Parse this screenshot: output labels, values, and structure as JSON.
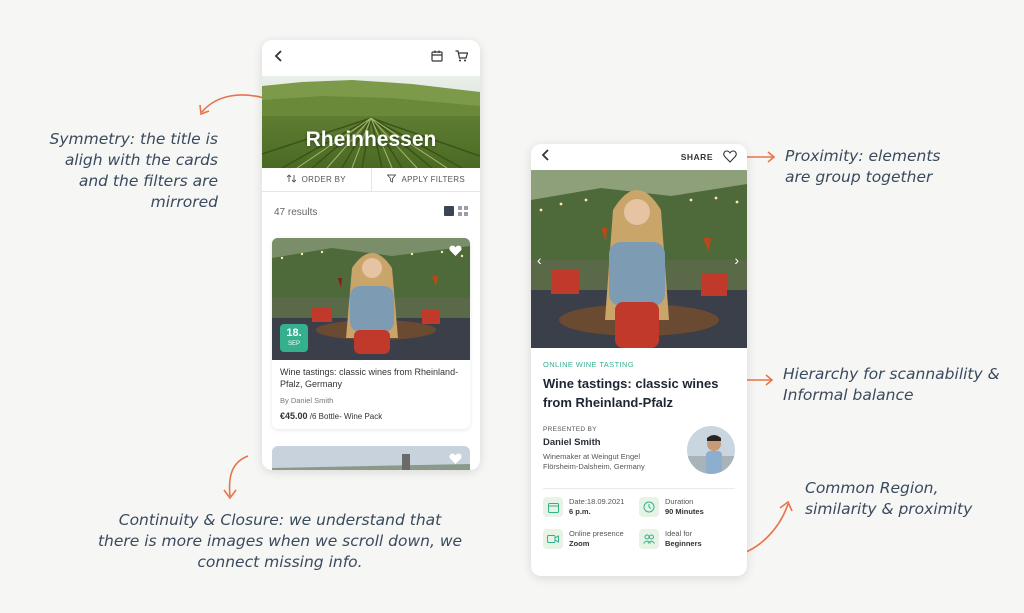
{
  "colors": {
    "accent": "#35b08f",
    "annotation_arrow": "#e8744a",
    "annotation_text": "#3a4a5e"
  },
  "annotations": {
    "symmetry": [
      "Symmetry: the title is",
      "aligh with the cards",
      "and the filters are",
      "mirrored"
    ],
    "continuity": [
      "Continuity & Closure: we understand that",
      "there is more images when we scroll down, we",
      "connect missing info."
    ],
    "proximity": [
      "Proximity: elements",
      "are group together"
    ],
    "hierarchy": [
      "Hierarchy for scannability &",
      "Informal balance"
    ],
    "common_region": [
      "Common Region,",
      "similarity & proximity"
    ]
  },
  "listing_screen": {
    "icons": [
      "back-chevron-icon",
      "calendar-icon",
      "cart-icon"
    ],
    "hero_title": "Rheinhessen",
    "order_by": "ORDER BY",
    "apply_filters": "APPLY FILTERS",
    "results": "47 results",
    "card": {
      "date_day": "18.",
      "date_month": "SEP",
      "title": "Wine tastings: classic wines from Rheinland-Pfalz, Germany",
      "by": "By Daniel Smith",
      "price": "€45.00",
      "price_note": "/6 Bottle- Wine Pack"
    }
  },
  "detail_screen": {
    "share": "SHARE",
    "category": "ONLINE WINE TASTING",
    "title": "Wine tastings: classic wines from Rheinland-Pfalz",
    "presented_by": "PRESENTED BY",
    "presenter_name": "Daniel Smith",
    "presenter_role_1": "Winemaker at Weingut Engel",
    "presenter_role_2": "Flörsheim-Dalsheim, Germany",
    "info": [
      {
        "icon": "calendar-icon",
        "label": "Date:18.09.2021",
        "value": "6 p.m."
      },
      {
        "icon": "clock-icon",
        "label": "Duration",
        "value": "90 Minutes"
      },
      {
        "icon": "video-icon",
        "label": "Online presence",
        "value": "Zoom"
      },
      {
        "icon": "people-icon",
        "label": "Ideal for",
        "value": "Beginners"
      }
    ]
  }
}
